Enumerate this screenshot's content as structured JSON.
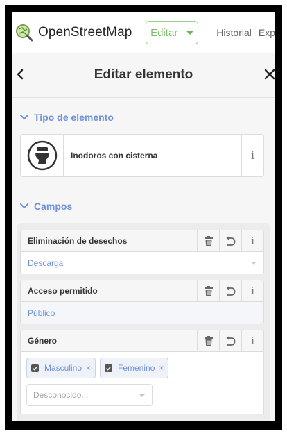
{
  "app": {
    "brand": "OpenStreetMap",
    "edit_label": "Editar",
    "nav": [
      "Historial",
      "Exp"
    ]
  },
  "editor": {
    "title": "Editar elemento"
  },
  "preset_section": {
    "heading": "Tipo de elemento",
    "preset_label": "Inodoros con cisterna",
    "info": "i"
  },
  "fields_section": {
    "heading": "Campos",
    "fields": [
      {
        "label": "Eliminación de desechos",
        "value": "Descarga"
      },
      {
        "label": "Acceso permitido",
        "value": "Público"
      },
      {
        "label": "Género",
        "chips": [
          "Masculino",
          "Femenino"
        ],
        "placeholder": "Desconocido..."
      }
    ],
    "info": "i",
    "chip_remove": "×"
  },
  "colors": {
    "accent": "#7092d9",
    "edit_green": "#7bbf6a",
    "panel_bg": "#f6f6f6"
  },
  "icons": [
    "osm-logo-icon",
    "chevron-down-icon",
    "back-arrow-icon",
    "close-icon",
    "toilet-icon",
    "trash-icon",
    "undo-icon",
    "info-icon",
    "checkbox-checked-icon"
  ]
}
